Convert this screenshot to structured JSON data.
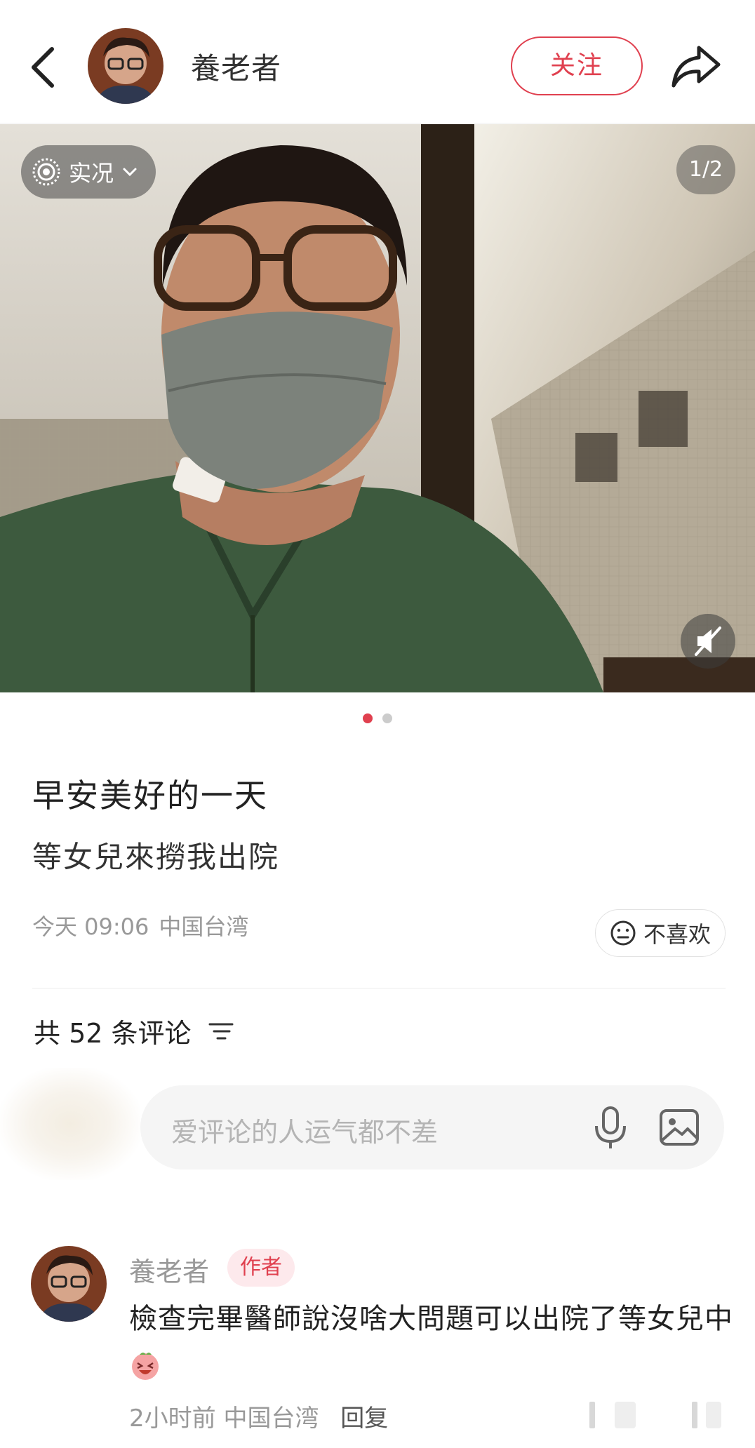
{
  "header": {
    "author_name": "養老者",
    "follow_label": "关注"
  },
  "media": {
    "live_label": "实况",
    "page_indicator": "1/2",
    "total_pages": 2,
    "current_page": 1
  },
  "post": {
    "title": "早安美好的一天",
    "body": "等女兒來撈我出院",
    "date": "今天 09:06",
    "location": "中国台湾",
    "dislike_label": "不喜欢"
  },
  "comments_section": {
    "count_label": "共 52 条评论",
    "input_placeholder": "爱评论的人运气都不差"
  },
  "comments": [
    {
      "name": "養老者",
      "badge": "作者",
      "text": "檢查完畢醫師說沒啥大問題可以出院了等女兒中",
      "time": "2小时前",
      "location": "中国台湾",
      "reply_label": "回复"
    }
  ],
  "colors": {
    "accent": "#e0404f",
    "dot_inactive": "#cccccc"
  }
}
